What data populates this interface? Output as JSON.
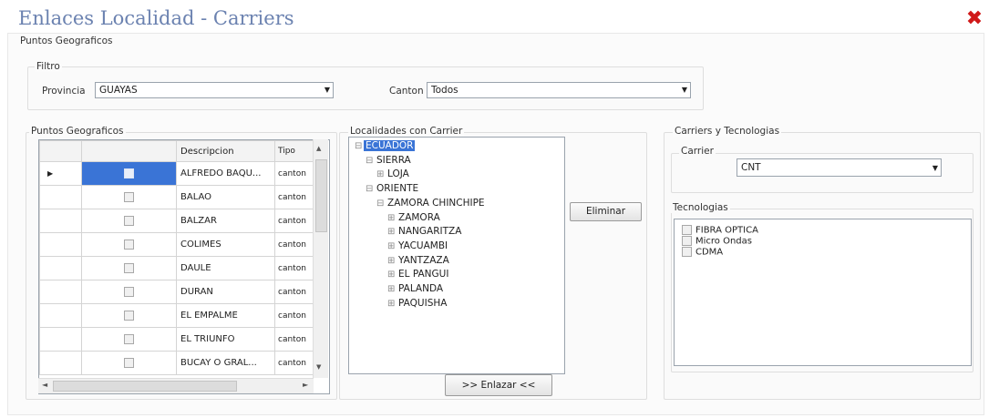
{
  "window": {
    "title": "Enlaces Localidad - Carriers",
    "close_icon": "close-icon",
    "close_color": "#d01818"
  },
  "top_group": {
    "title": "Puntos Geograficos",
    "filter_title": "Filtro",
    "provincia_label": "Provincia",
    "provincia_value": "GUAYAS",
    "canton_label": "Canton",
    "canton_value": "Todos"
  },
  "grid": {
    "title": "Puntos Geograficos",
    "columns": [
      "",
      "",
      "Descripcion",
      "Tipo"
    ],
    "rows": [
      {
        "descripcion": "ALFREDO BAQU...",
        "tipo": "canton",
        "selected": true
      },
      {
        "descripcion": "BALAO",
        "tipo": "canton",
        "selected": false
      },
      {
        "descripcion": "BALZAR",
        "tipo": "canton",
        "selected": false
      },
      {
        "descripcion": "COLIMES",
        "tipo": "canton",
        "selected": false
      },
      {
        "descripcion": "DAULE",
        "tipo": "canton",
        "selected": false
      },
      {
        "descripcion": "DURAN",
        "tipo": "canton",
        "selected": false
      },
      {
        "descripcion": "EL EMPALME",
        "tipo": "canton",
        "selected": false
      },
      {
        "descripcion": "EL TRIUNFO",
        "tipo": "canton",
        "selected": false
      },
      {
        "descripcion": "BUCAY O GRAL...",
        "tipo": "canton",
        "selected": false
      }
    ]
  },
  "tree": {
    "title": "Localidades con Carrier",
    "nodes": [
      {
        "label": "ECUADOR",
        "level": 0,
        "glyph": "⊟",
        "selected": true
      },
      {
        "label": "SIERRA",
        "level": 1,
        "glyph": "⊟",
        "selected": false
      },
      {
        "label": "LOJA",
        "level": 2,
        "glyph": "⊞",
        "selected": false
      },
      {
        "label": "ORIENTE",
        "level": 1,
        "glyph": "⊟",
        "selected": false
      },
      {
        "label": "ZAMORA CHINCHIPE",
        "level": 2,
        "glyph": "⊟",
        "selected": false
      },
      {
        "label": "ZAMORA",
        "level": 3,
        "glyph": "⊞",
        "selected": false
      },
      {
        "label": "NANGARITZA",
        "level": 3,
        "glyph": "⊞",
        "selected": false
      },
      {
        "label": "YACUAMBI",
        "level": 3,
        "glyph": "⊞",
        "selected": false
      },
      {
        "label": "YANTZAZA",
        "level": 3,
        "glyph": "⊞",
        "selected": false
      },
      {
        "label": "EL PANGUI",
        "level": 3,
        "glyph": "⊞",
        "selected": false
      },
      {
        "label": "PALANDA",
        "level": 3,
        "glyph": "⊞",
        "selected": false
      },
      {
        "label": "PAQUISHA",
        "level": 3,
        "glyph": "⊞",
        "selected": false
      }
    ],
    "selection_color": "#3a74d6"
  },
  "buttons": {
    "eliminar": "Eliminar",
    "enlazar": ">> Enlazar <<"
  },
  "carriers": {
    "title": "Carriers y Tecnologias",
    "carrier_group_title": "Carrier",
    "carrier_value": "CNT",
    "tech_group_title": "Tecnologias",
    "technologies": [
      "FIBRA OPTICA",
      "Micro Ondas",
      "CDMA"
    ]
  }
}
